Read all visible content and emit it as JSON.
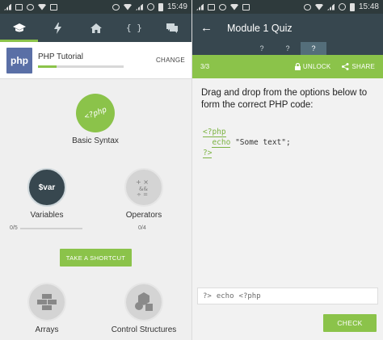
{
  "left": {
    "status": {
      "time": "15:49"
    },
    "tabs": [
      {
        "name": "learn-tab",
        "icon": "graduation-cap-icon",
        "glyph": "🎓",
        "active": true
      },
      {
        "name": "flash-tab",
        "icon": "bolt-icon",
        "glyph": "⚡",
        "active": false
      },
      {
        "name": "home-tab",
        "icon": "home-icon",
        "glyph": "⌂",
        "active": false
      },
      {
        "name": "code-tab",
        "icon": "braces-icon",
        "glyph": "{ }",
        "active": false
      },
      {
        "name": "discuss-tab",
        "icon": "chat-icon",
        "glyph": "▬",
        "active": false
      }
    ],
    "course": {
      "logo_text": "php",
      "title": "PHP Tutorial",
      "change_label": "CHANGE",
      "progress_percent": 22
    },
    "nodes": {
      "basic_syntax": {
        "icon_text": "<?php",
        "label": "Basic Syntax"
      },
      "variables": {
        "icon_text": "$var",
        "label": "Variables",
        "progress": "0/5"
      },
      "operators": {
        "icon_text": "+ ×\n&&\n÷ =",
        "label": "Operators",
        "progress": "0/4"
      },
      "arrays": {
        "label": "Arrays"
      },
      "control_structures": {
        "label": "Control Structures"
      }
    },
    "shortcut_label": "TAKE A SHORTCUT"
  },
  "right": {
    "status": {
      "time": "15:48"
    },
    "title": "Module 1 Quiz",
    "question_tabs": [
      "?",
      "?",
      "?"
    ],
    "counter": "3/3",
    "unlock_label": "UNLOCK",
    "share_label": "SHARE",
    "question": "Drag and drop from the options below to form the correct PHP code:",
    "code": {
      "line1": "<?php",
      "line2_kw": "echo",
      "line2_str": "\"Some text\";",
      "line3": "?>"
    },
    "options": [
      "?>",
      "echo",
      "<?php"
    ],
    "check_label": "CHECK"
  },
  "colors": {
    "accent": "#8bc34a",
    "toolbar": "#37474f",
    "node_dark": "#37474f",
    "node_gray": "#c9c9c9"
  }
}
